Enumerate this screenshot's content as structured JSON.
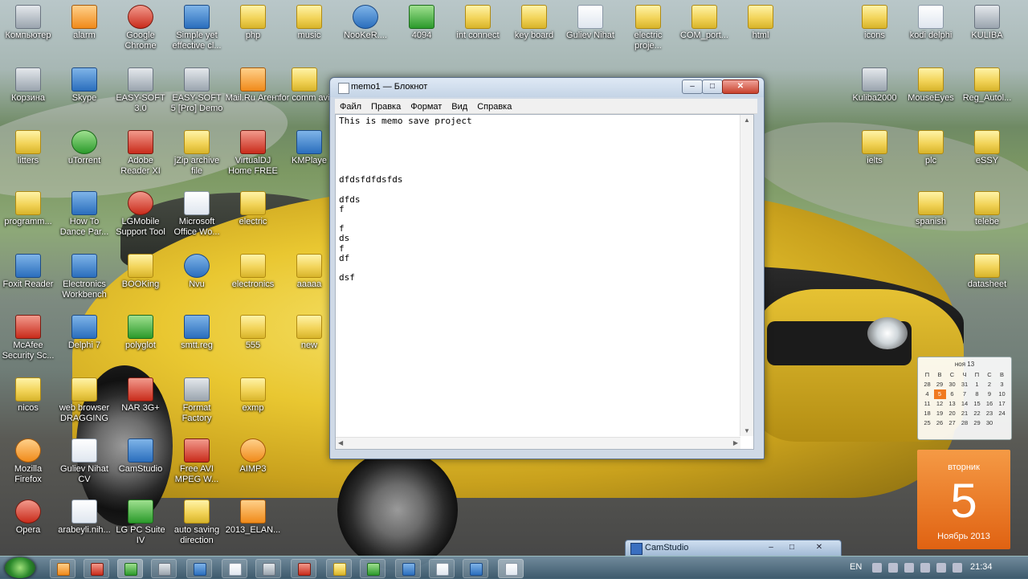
{
  "desktop": {
    "icons": [
      {
        "label": "Компьютер"
      },
      {
        "label": "alarm"
      },
      {
        "label": "Google Chrome"
      },
      {
        "label": "Simple yet effective cl..."
      },
      {
        "label": "php"
      },
      {
        "label": "music"
      },
      {
        "label": "NooKeR...."
      },
      {
        "label": "4094"
      },
      {
        "label": "int connect"
      },
      {
        "label": "key board"
      },
      {
        "label": "Guliev Nihat"
      },
      {
        "label": "electric proje..."
      },
      {
        "label": "COM_port..."
      },
      {
        "label": "html"
      },
      {
        "label": "icons"
      },
      {
        "label": "kodi delphi"
      },
      {
        "label": "KULIBA"
      },
      {
        "label": "Корзина"
      },
      {
        "label": "Skype"
      },
      {
        "label": "EASY-SOFT 3.0"
      },
      {
        "label": "EASY-SOFT 5 [Pro] Demo"
      },
      {
        "label": "Mail.Ru Агент"
      },
      {
        "label": "for comm avi"
      },
      {
        "label": "Kuliba2000"
      },
      {
        "label": "MouseEyes"
      },
      {
        "label": "Reg_Autol..."
      },
      {
        "label": "litters"
      },
      {
        "label": "uTorrent"
      },
      {
        "label": "Adobe Reader XI"
      },
      {
        "label": "jZip archive file"
      },
      {
        "label": "VirtualDJ Home FREE"
      },
      {
        "label": "KMPlaye"
      },
      {
        "label": "ielts"
      },
      {
        "label": "plc"
      },
      {
        "label": "eSSY"
      },
      {
        "label": "programm..."
      },
      {
        "label": "How To Dance Par..."
      },
      {
        "label": "LGMobile Support Tool"
      },
      {
        "label": "Microsoft Office Wo..."
      },
      {
        "label": "electric"
      },
      {
        "label": "spanish"
      },
      {
        "label": "telebe"
      },
      {
        "label": "Foxit Reader"
      },
      {
        "label": "Electronics Workbench"
      },
      {
        "label": "BOOKing"
      },
      {
        "label": "Nvu"
      },
      {
        "label": "electronics"
      },
      {
        "label": "aaaaa"
      },
      {
        "label": "datasheet"
      },
      {
        "label": "McAfee Security Sc..."
      },
      {
        "label": "Delphi 7"
      },
      {
        "label": "polyglot"
      },
      {
        "label": "smtt.reg"
      },
      {
        "label": "555"
      },
      {
        "label": "new"
      },
      {
        "label": "nicos"
      },
      {
        "label": "web browser DRAGGING"
      },
      {
        "label": "NAR 3G+"
      },
      {
        "label": "Format Factory"
      },
      {
        "label": "exmp"
      },
      {
        "label": "Mozilla Firefox"
      },
      {
        "label": "Guliev Nihat CV"
      },
      {
        "label": "CamStudio"
      },
      {
        "label": "Free AVI MPEG W..."
      },
      {
        "label": "AIMP3"
      },
      {
        "label": "Opera"
      },
      {
        "label": "arabeyli.nih..."
      },
      {
        "label": "LG PC Suite IV"
      },
      {
        "label": "auto saving direction"
      },
      {
        "label": "2013_ELAN..."
      }
    ]
  },
  "notepad": {
    "title": "memo1 — Блокнот",
    "menu": [
      "Файл",
      "Правка",
      "Формат",
      "Вид",
      "Справка"
    ],
    "content": "This is memo save project\n\n\n\n\n\ndfdsfdfdsfds\n\ndfds\nf\n\nf\nds\nf\ndf\n\ndsf"
  },
  "calendar": {
    "month": "ноя 13",
    "weekdays": [
      "П",
      "В",
      "С",
      "Ч",
      "П",
      "С",
      "В"
    ],
    "weeks": [
      [
        "28",
        "29",
        "30",
        "31",
        "1",
        "2",
        "3"
      ],
      [
        "4",
        "5",
        "6",
        "7",
        "8",
        "9",
        "10"
      ],
      [
        "11",
        "12",
        "13",
        "14",
        "15",
        "16",
        "17"
      ],
      [
        "18",
        "19",
        "20",
        "21",
        "22",
        "23",
        "24"
      ],
      [
        "25",
        "26",
        "27",
        "28",
        "29",
        "30",
        ""
      ]
    ],
    "weekday_name": "вторник",
    "day": "5",
    "month_year": "Ноябрь 2013"
  },
  "camstudio": {
    "title": "CamStudio"
  },
  "taskbar": {
    "lang": "EN",
    "time": "21:34"
  }
}
